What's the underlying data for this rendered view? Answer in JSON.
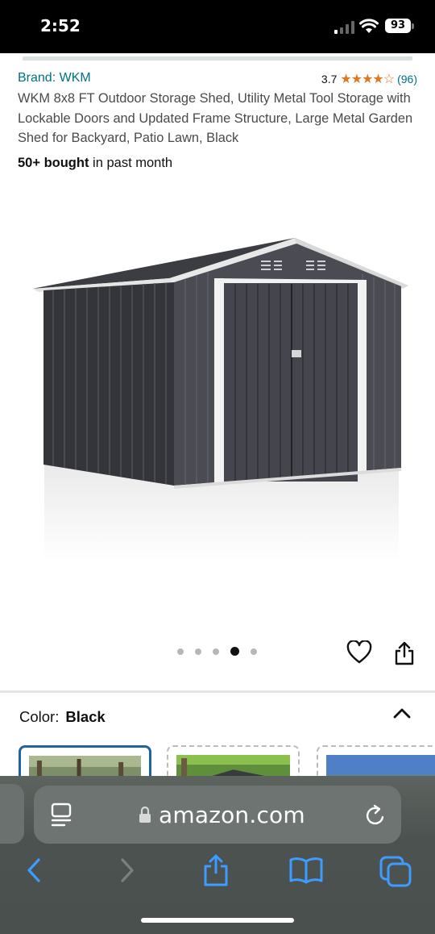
{
  "status_bar": {
    "time": "2:52",
    "battery_level": "93",
    "icons": [
      "signal-icon",
      "wifi-icon",
      "battery-icon"
    ]
  },
  "product": {
    "brand_label": "Brand: WKM",
    "rating_value": "3.7",
    "rating_stars": 3.7,
    "review_count": "(96)",
    "title": "WKM 8x8 FT Outdoor Storage Shed, Utility Metal Tool Storage with Lockable Doors and Updated Frame Structure, Large Metal Garden Shed for Backyard, Patio Lawn, Black",
    "bought_bold": "50+ bought",
    "bought_rest": " in past month"
  },
  "gallery": {
    "image_count": 5,
    "active_index": 4,
    "icons": [
      "heart-icon",
      "share-icon"
    ]
  },
  "variation": {
    "label": "Color:",
    "value": "Black",
    "icon": "chevron-up-icon",
    "swatches": 3,
    "selected_swatch": 1
  },
  "safari": {
    "url": "amazon.com",
    "icons": [
      "reader-icon",
      "lock-icon",
      "reload-icon",
      "back-icon",
      "forward-icon",
      "share-icon",
      "bookmarks-icon",
      "tabs-icon"
    ]
  },
  "colors": {
    "link": "#007185",
    "star": "#de7921",
    "safari_accent": "#3d9cff",
    "selected_border": "#2162a1"
  }
}
